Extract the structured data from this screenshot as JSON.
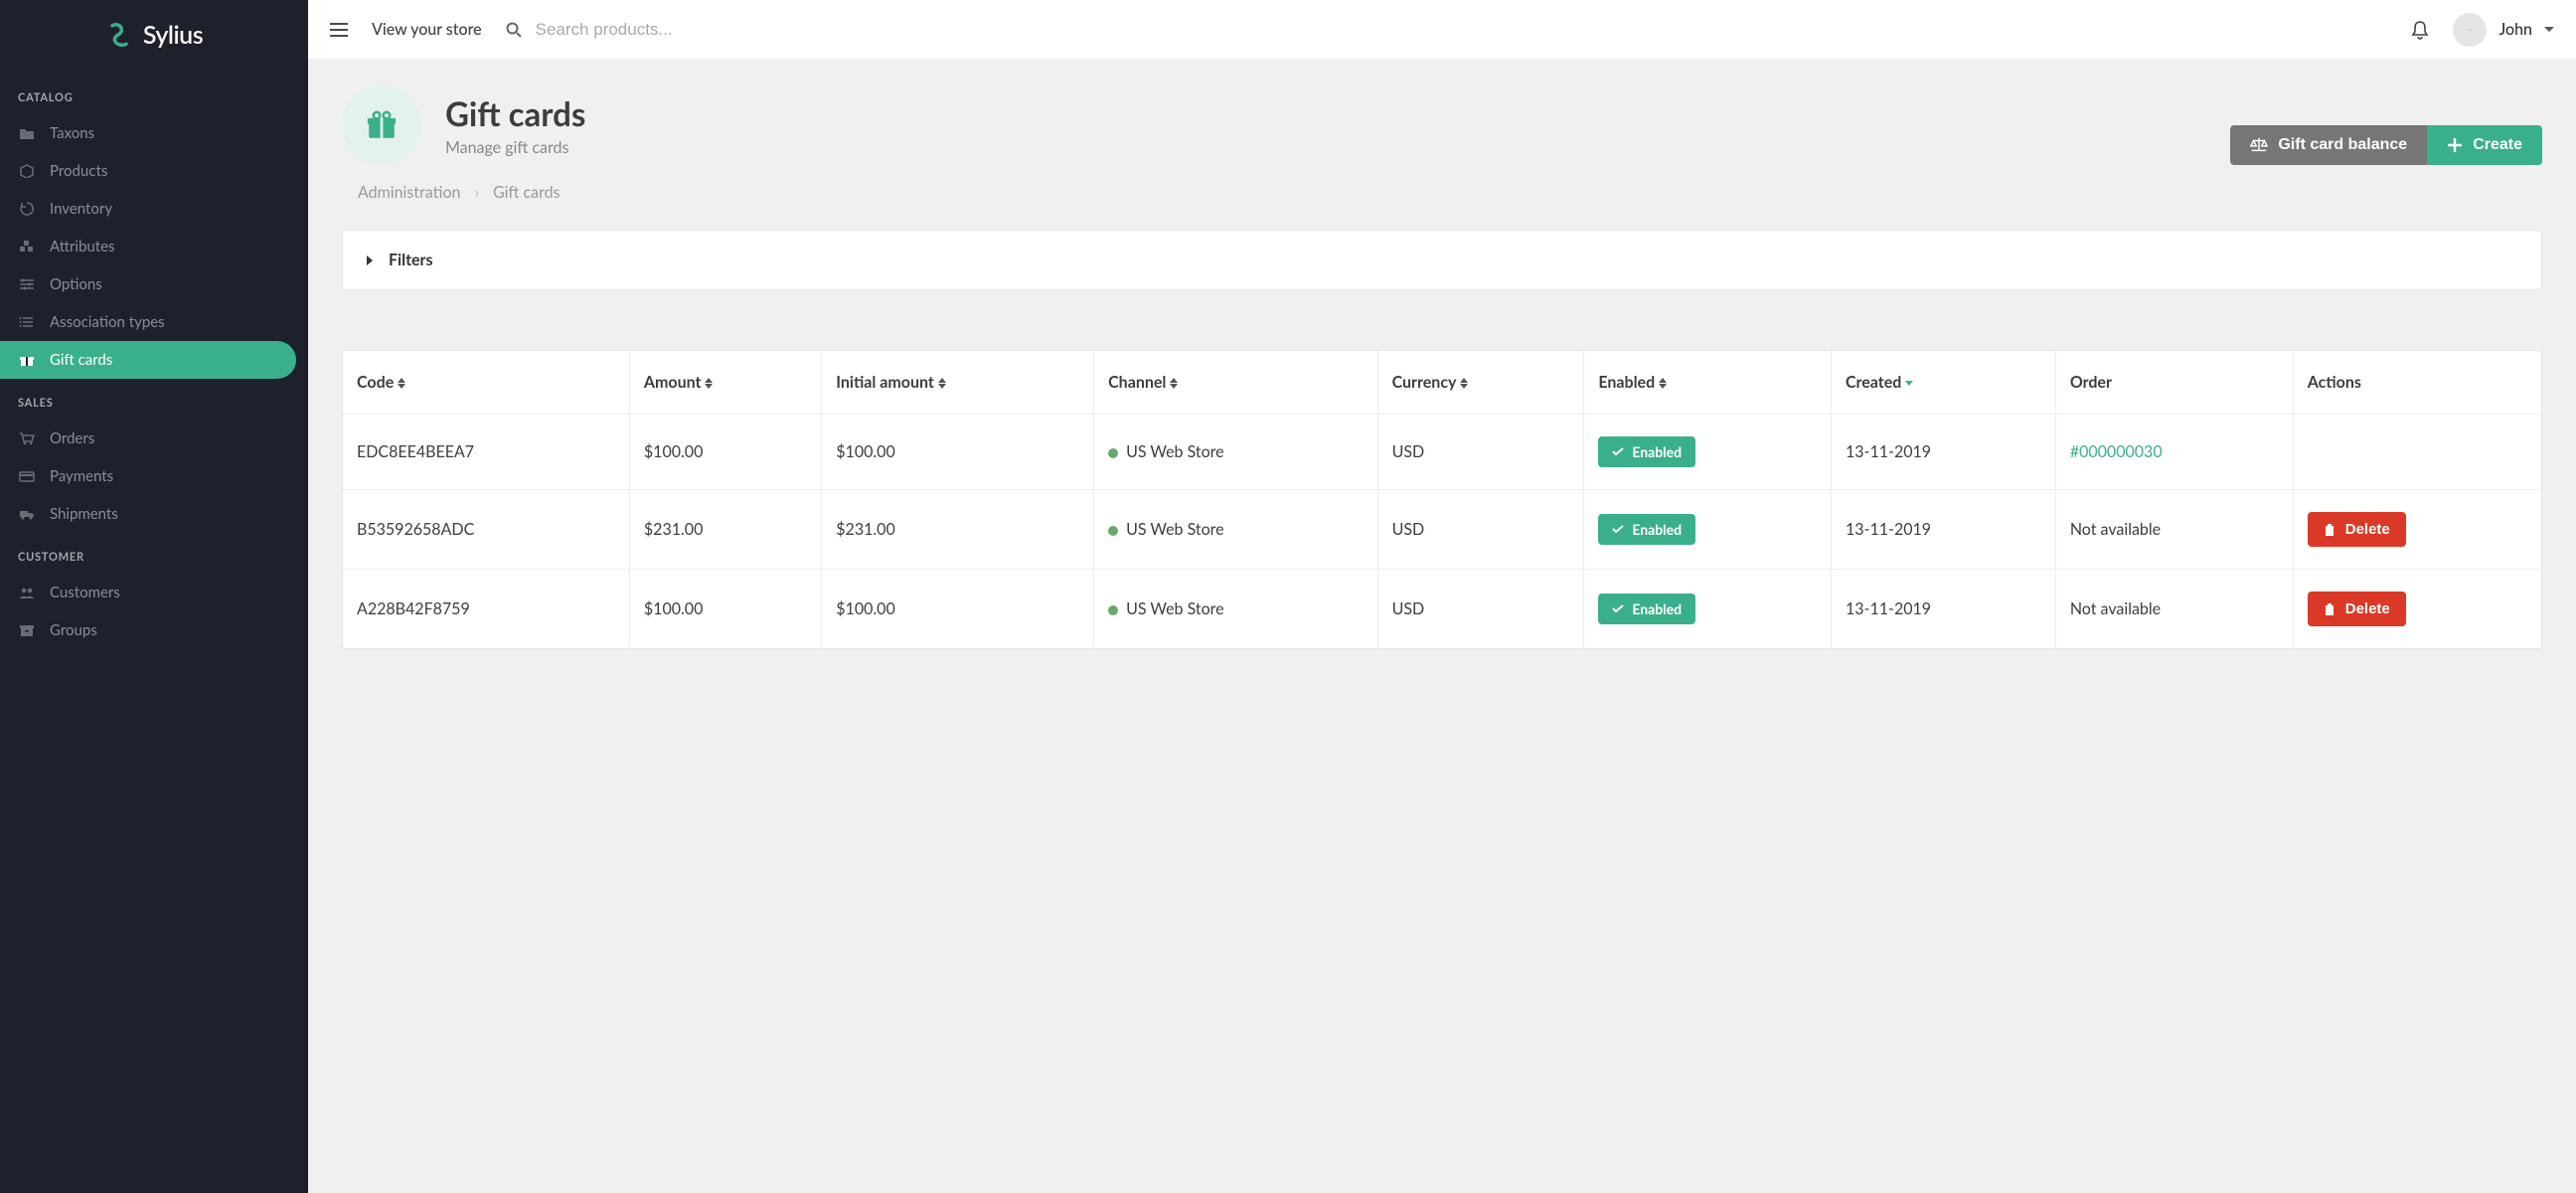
{
  "brand": "Sylius",
  "header": {
    "view_store": "View your store",
    "search_placeholder": "Search products...",
    "user_name": "John"
  },
  "sidebar": {
    "sections": [
      {
        "title": "CATALOG",
        "items": [
          {
            "label": "Taxons",
            "icon": "folder"
          },
          {
            "label": "Products",
            "icon": "box"
          },
          {
            "label": "Inventory",
            "icon": "history"
          },
          {
            "label": "Attributes",
            "icon": "cubes"
          },
          {
            "label": "Options",
            "icon": "sliders"
          },
          {
            "label": "Association types",
            "icon": "list"
          },
          {
            "label": "Gift cards",
            "icon": "gift",
            "active": true
          }
        ]
      },
      {
        "title": "SALES",
        "items": [
          {
            "label": "Orders",
            "icon": "cart"
          },
          {
            "label": "Payments",
            "icon": "card"
          },
          {
            "label": "Shipments",
            "icon": "truck"
          }
        ]
      },
      {
        "title": "CUSTOMER",
        "items": [
          {
            "label": "Customers",
            "icon": "users"
          },
          {
            "label": "Groups",
            "icon": "archive"
          }
        ]
      }
    ]
  },
  "page": {
    "title": "Gift cards",
    "subtitle": "Manage gift cards",
    "actions": {
      "balance": "Gift card balance",
      "create": "Create"
    }
  },
  "breadcrumb": {
    "root": "Administration",
    "current": "Gift cards"
  },
  "filters_label": "Filters",
  "table": {
    "headers": {
      "code": "Code",
      "amount": "Amount",
      "initial_amount": "Initial amount",
      "channel": "Channel",
      "currency": "Currency",
      "enabled": "Enabled",
      "created": "Created",
      "order": "Order",
      "actions": "Actions"
    },
    "enabled_label": "Enabled",
    "delete_label": "Delete",
    "not_available": "Not available",
    "rows": [
      {
        "code": "EDC8EE4BEEA7",
        "amount": "$100.00",
        "initial_amount": "$100.00",
        "channel": "US Web Store",
        "currency": "USD",
        "enabled": true,
        "created": "13-11-2019",
        "order": "#000000030"
      },
      {
        "code": "B53592658ADC",
        "amount": "$231.00",
        "initial_amount": "$231.00",
        "channel": "US Web Store",
        "currency": "USD",
        "enabled": true,
        "created": "13-11-2019",
        "order": null
      },
      {
        "code": "A228B42F8759",
        "amount": "$100.00",
        "initial_amount": "$100.00",
        "channel": "US Web Store",
        "currency": "USD",
        "enabled": true,
        "created": "13-11-2019",
        "order": null
      }
    ]
  }
}
